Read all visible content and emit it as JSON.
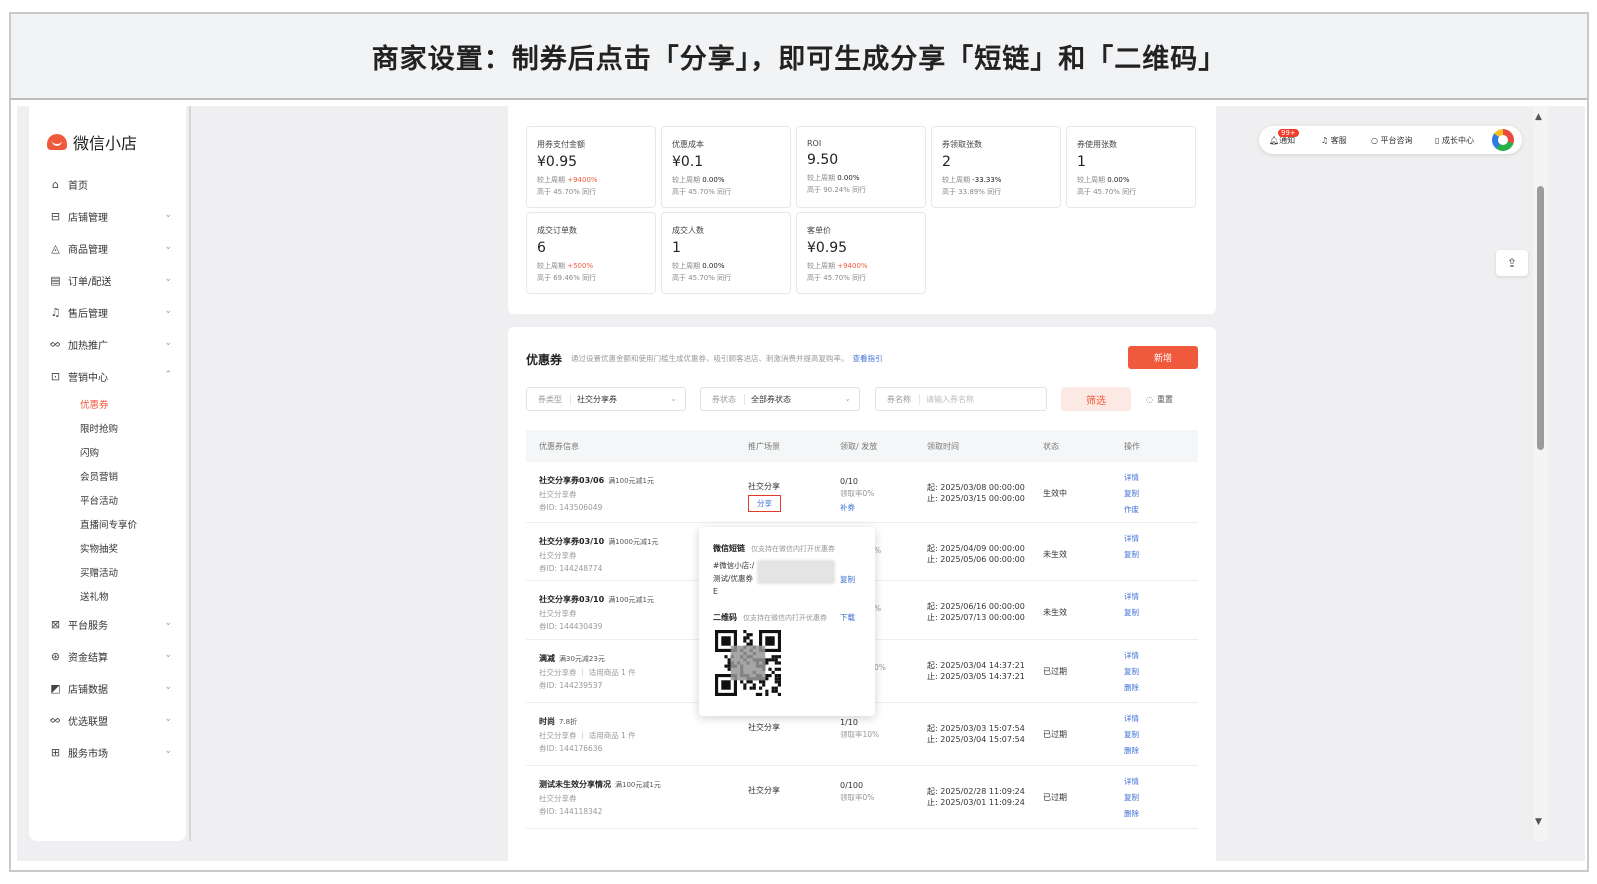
{
  "banner": {
    "title": "商家设置：制券后点击「分享」，即可生成分享「短链」和「二维码」"
  },
  "sidebar": {
    "logo": "微信小店",
    "items": [
      {
        "icon": "⌂",
        "label": "首页",
        "chevron": ""
      },
      {
        "icon": "⊟",
        "label": "店铺管理",
        "chevron": "⌄"
      },
      {
        "icon": "◬",
        "label": "商品管理",
        "chevron": "⌄"
      },
      {
        "icon": "▤",
        "label": "订单/配送",
        "chevron": "⌄"
      },
      {
        "icon": "♫",
        "label": "售后管理",
        "chevron": "⌄"
      },
      {
        "icon": "ᨖ",
        "label": "加热推广",
        "chevron": "⌄"
      },
      {
        "icon": "⊡",
        "label": "营销中心",
        "chevron": "⌃"
      }
    ],
    "subitems": [
      "优惠券",
      "限时抢购",
      "闪购",
      "会员营销",
      "平台活动",
      "直播间专享价",
      "实物抽奖",
      "买赠活动",
      "送礼物"
    ],
    "items_after": [
      {
        "icon": "⊠",
        "label": "平台服务",
        "chevron": "⌄"
      },
      {
        "icon": "⊛",
        "label": "资金结算",
        "chevron": "⌄"
      },
      {
        "icon": "◩",
        "label": "店铺数据",
        "chevron": "⌄"
      },
      {
        "icon": "ᨖ",
        "label": "优选联盟",
        "chevron": "⌄"
      },
      {
        "icon": "⊞",
        "label": "服务市场",
        "chevron": "⌄"
      }
    ]
  },
  "stats": [
    {
      "label": "用券支付金额",
      "value": "¥0.95",
      "cmp_prefix": "较上周期",
      "cmp": "+9400%",
      "cmp_red": true,
      "peer": "高于 45.70% 同行"
    },
    {
      "label": "优惠成本",
      "value": "¥0.1",
      "cmp_prefix": "较上周期",
      "cmp": "0.00%",
      "cmp_red": false,
      "peer": "高于 45.70% 同行"
    },
    {
      "label": "ROI",
      "value": "9.50",
      "cmp_prefix": "较上周期",
      "cmp": "0.00%",
      "cmp_red": false,
      "peer": "高于 90.24% 同行"
    },
    {
      "label": "券领取张数",
      "value": "2",
      "cmp_prefix": "较上周期",
      "cmp": "-33.33%",
      "cmp_red": false,
      "peer": "高于 33.89% 同行"
    },
    {
      "label": "券使用张数",
      "value": "1",
      "cmp_prefix": "较上周期",
      "cmp": "0.00%",
      "cmp_red": false,
      "peer": "高于 45.70% 同行"
    },
    {
      "label": "成交订单数",
      "value": "6",
      "cmp_prefix": "较上周期",
      "cmp": "+500%",
      "cmp_red": true,
      "peer": "高于 69.46% 同行"
    },
    {
      "label": "成交人数",
      "value": "1",
      "cmp_prefix": "较上周期",
      "cmp": "0.00%",
      "cmp_red": false,
      "peer": "高于 45.70% 同行"
    },
    {
      "label": "客单价",
      "value": "¥0.95",
      "cmp_prefix": "较上周期",
      "cmp": "+9400%",
      "cmp_red": true,
      "peer": "高于 45.70% 同行"
    }
  ],
  "coupon": {
    "title": "优惠券",
    "desc": "通过设置优惠金额和使用门槛生成优惠券，吸引顾客进店、刺激消费并提高复购率。",
    "guide": "查看指引",
    "add": "新增",
    "filters": {
      "type_label": "券类型",
      "type_value": "社交分享券",
      "status_label": "券状态",
      "status_value": "全部券状态",
      "name_label": "券名称",
      "name_placeholder": "请输入券名称",
      "search": "筛选",
      "reset": "重置"
    },
    "headers": [
      "优惠券信息",
      "推广场景",
      "领取/ 发放",
      "领取时间",
      "状态",
      "操作"
    ],
    "rows": [
      {
        "name": "社交分享券03/06",
        "rule": "满100元减1元",
        "type": "社交分享券",
        "id": "券ID: 143506049",
        "scene": "社交分享",
        "share": "分享",
        "issued": "0/10",
        "rate": "领取率0%",
        "extra": "补券",
        "start": "起: 2025/03/08 00:00:00",
        "end": "止: 2025/03/15 00:00:00",
        "status": "生效中",
        "ops": [
          "详情",
          "复制",
          "作废"
        ]
      },
      {
        "name": "社交分享券03/10",
        "rule": "满1000元减1元",
        "type": "社交分享券",
        "id": "券ID: 144248774",
        "scene": "",
        "issued": "",
        "rate": "%",
        "start": "起: 2025/04/09 00:00:00",
        "end": "止: 2025/05/06 00:00:00",
        "status": "未生效",
        "ops": [
          "详情",
          "复制"
        ]
      },
      {
        "name": "社交分享券03/10",
        "rule": "满100元减1元",
        "type": "社交分享券",
        "id": "券ID: 144430439",
        "scene": "",
        "issued": "",
        "rate": "%",
        "start": "起: 2025/06/16 00:00:00",
        "end": "止: 2025/07/13 00:00:00",
        "status": "未生效",
        "ops": [
          "详情",
          "复制"
        ]
      },
      {
        "name": "满减",
        "rule": "满30元减23元",
        "type": "社交分享券 ｜ 适用商品 1 件",
        "id": "券ID: 144239537",
        "scene": "",
        "issued": "",
        "rate": "0%",
        "start": "起: 2025/03/04 14:37:21",
        "end": "止: 2025/03/05 14:37:21",
        "status": "已过期",
        "ops": [
          "详情",
          "复制",
          "删除"
        ]
      },
      {
        "name": "时尚",
        "rule": "7.8折",
        "type": "社交分享券 ｜ 适用商品 1 件",
        "id": "券ID: 144176636",
        "scene": "社交分享",
        "issued": "1/10",
        "rate": "领取率10%",
        "start": "起: 2025/03/03 15:07:54",
        "end": "止: 2025/03/04 15:07:54",
        "status": "已过期",
        "ops": [
          "详情",
          "复制",
          "删除"
        ]
      },
      {
        "name": "测试未生效分享情况",
        "rule": "满100元减1元",
        "type": "社交分享券",
        "id": "券ID: 144118342",
        "scene": "社交分享",
        "issued": "0/100",
        "rate": "领取率0%",
        "start": "起: 2025/02/28 11:09:24",
        "end": "止: 2025/03/01 11:09:24",
        "status": "已过期",
        "ops": [
          "详情",
          "复制",
          "删除"
        ]
      }
    ]
  },
  "popover": {
    "link_title": "微信短链",
    "link_note": "仅支持在微信内打开优惠券",
    "link_text_1": "#微信小店:/",
    "link_text_2": "测试/优惠券",
    "link_text_3": "E",
    "copy": "复制",
    "qr_title": "二维码",
    "qr_note": "仅支持在微信内打开优惠券",
    "download": "下载"
  },
  "topbar": {
    "notify": "通知",
    "badge": "99+",
    "service": "客服",
    "consult": "平台咨询",
    "growth": "成长中心"
  },
  "colors": {
    "accent": "#f05a3c",
    "link": "#3b6fd6",
    "highlight_box": "#e03a2a"
  }
}
